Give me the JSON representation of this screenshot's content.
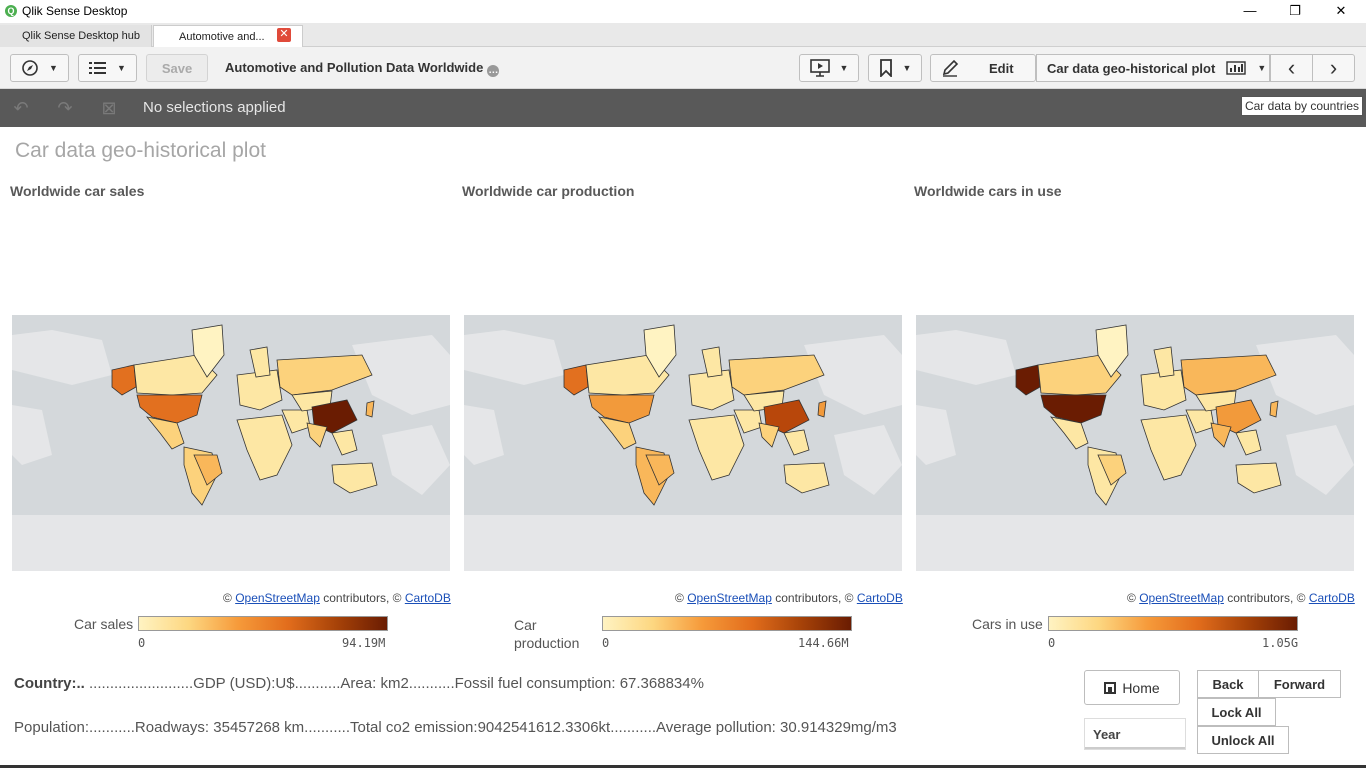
{
  "window": {
    "title": "Qlik Sense Desktop",
    "logo_glyph": "Q",
    "min_glyph": "—",
    "restore_glyph": "❐",
    "close_glyph": "✕"
  },
  "tabs": [
    {
      "label": "Qlik Sense Desktop hub"
    },
    {
      "label": "Automotive and..."
    }
  ],
  "tab_close_glyph": "✕",
  "toolbar": {
    "save_label": "Save",
    "app_title": "Automotive and Pollution Data Worldwide",
    "edit_label": "Edit",
    "sheet_selector": "Car data geo-historical plot",
    "prev_glyph": "‹",
    "next_glyph": "›"
  },
  "selections": {
    "text": "No selections applied"
  },
  "tooltip": "Car data by countries",
  "sheet": {
    "title": "Car data geo-historical plot"
  },
  "charts": [
    {
      "title": "Worldwide car sales",
      "legend_title": "Car sales",
      "legend_min": "0",
      "legend_max": "94.19M"
    },
    {
      "title": "Worldwide car production",
      "legend_title": "Car production",
      "legend_min": "0",
      "legend_max": "144.66M"
    },
    {
      "title": "Worldwide cars in use",
      "legend_title": "Cars in use",
      "legend_min": "0",
      "legend_max": "1.05G"
    }
  ],
  "attribution": {
    "prefix": "©",
    "osm": "OpenStreetMap",
    "mid": "contributors, ©",
    "carto": "CartoDB"
  },
  "kpis": {
    "line1_label": "Country:..",
    "line1_rest": " .........................GDP (USD):U$...........Area: km2...........Fossil fuel consumption: 67.368834%",
    "line2": "Population:...........Roadways: 35457268 km...........Total co2 emission:9042541612.3306kt...........Average pollution: 30.914329mg/m3"
  },
  "buttons": {
    "home": "Home",
    "back": "Back",
    "forward": "Forward",
    "lock_all": "Lock All",
    "unlock_all": "Unlock All",
    "year": "Year"
  },
  "colors": {
    "sel_bar": "#595959",
    "map_water": "#d4d8db",
    "map_land_base": "#f4f4f4",
    "scale_low": "#fff3c2",
    "scale_high": "#6a1c02"
  }
}
